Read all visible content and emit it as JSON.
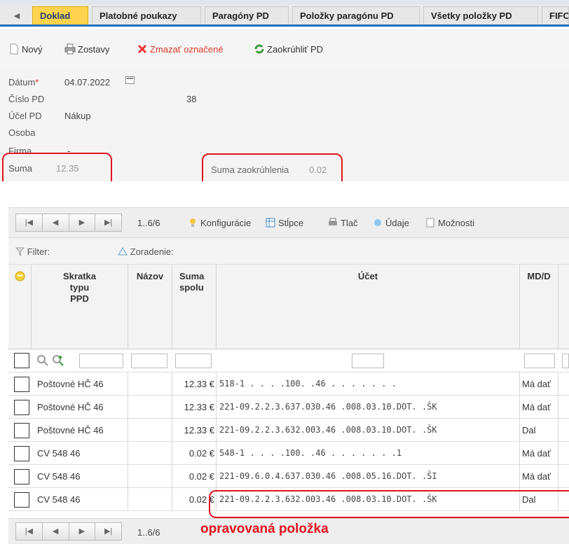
{
  "tabs": [
    "Doklad",
    "Platobné poukazy",
    "Paragóny PD",
    "Položky paragónu PD",
    "Všetky položky PD",
    "FIFO"
  ],
  "active_tab": "Doklad",
  "toolbar": {
    "new_label": "Nový",
    "reports_label": "Zostavy",
    "delete_label": "Zmazať označené",
    "round_label": "Zaokrúhliť PD"
  },
  "form": {
    "date_label": "Dátum",
    "date_required_mark": "*",
    "date_value": "04.07.2022",
    "number_label": "Číslo PD",
    "number_value": "38",
    "purpose_label": "Účel PD",
    "purpose_value": "Nákup",
    "person_label": "Osoba",
    "company_label": "Firma",
    "company_value": "-",
    "sum_label": "Suma",
    "sum_value": "12.35",
    "rounding_label": "Suma zaokrúhlenia",
    "rounding_value": "0.02"
  },
  "grid": {
    "page_info": "1..6/6",
    "toolbar": {
      "config_label": "Konfigurácie",
      "columns_label": "Stĺpce",
      "print_label": "Tlač",
      "data_label": "Údaje",
      "options_label": "Možnosti"
    },
    "filter_label": "Filter:",
    "sort_label": "Zoradenie:",
    "columns": {
      "type": "Skratka\ntypu\nPPD",
      "name": "Názov",
      "sum": "Suma\nspolu",
      "account": "Účet",
      "mdd": "MD/D"
    },
    "rows": [
      {
        "type": "Poštovné HČ 46",
        "sum": "12.33 €",
        "account": "518-1 . . . .100.  .46  .  .  .  .  .  .  .",
        "mdd": "Má dať"
      },
      {
        "type": "Poštovné HČ 46",
        "sum": "12.33 €",
        "account": "221-09.2.2.3.637.030.46  .008.03.10.DOT.  .ŠK",
        "mdd": "Má dať"
      },
      {
        "type": "Poštovné HČ 46",
        "sum": "12.33 €",
        "account": "221-09.2.2.3.632.003.46  .008.03.10.DOT.  .ŠK",
        "mdd": "Dal"
      },
      {
        "type": "CV 548 46",
        "sum": "0.02 €",
        "account": "548-1 . . . .100.  .46  .  .  .  .  .  .  .1",
        "mdd": "Má dať"
      },
      {
        "type": "CV 548 46",
        "sum": "0.02 €",
        "account": "221-09.6.0.4.637.030.46  .008.05.16.DOT.  .ŠI",
        "mdd": "Má dať"
      },
      {
        "type": "CV 548 46",
        "sum": "0.02 €",
        "account": "221-09.2.2.3.632.003.46  .008.03.10.DOT.  .ŠK",
        "mdd": "Dal"
      }
    ],
    "bottom_page_info": "1..6/6"
  },
  "annotation": "opravovaná položka",
  "colors": {
    "accent_blue": "#1f6fbf",
    "active_tab": "#ffd34d",
    "annotation_red": "#e0141d"
  }
}
